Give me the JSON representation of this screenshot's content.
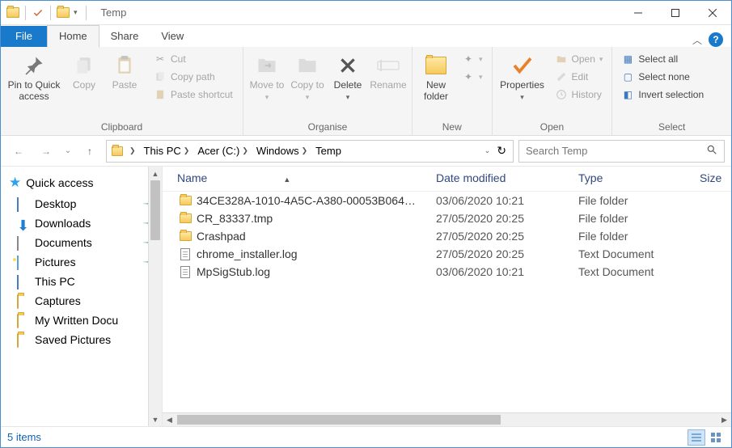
{
  "title": "Temp",
  "tabs": {
    "file": "File",
    "home": "Home",
    "share": "Share",
    "view": "View"
  },
  "ribbon": {
    "clipboard": {
      "label": "Clipboard",
      "pin": "Pin to Quick access",
      "copy": "Copy",
      "paste": "Paste",
      "cut": "Cut",
      "copy_path": "Copy path",
      "paste_shortcut": "Paste shortcut"
    },
    "organise": {
      "label": "Organise",
      "move_to": "Move to",
      "copy_to": "Copy to",
      "delete": "Delete",
      "rename": "Rename"
    },
    "new": {
      "label": "New",
      "new_folder": "New folder"
    },
    "open": {
      "label": "Open",
      "properties": "Properties",
      "open": "Open",
      "edit": "Edit",
      "history": "History"
    },
    "select": {
      "label": "Select",
      "all": "Select all",
      "none": "Select none",
      "invert": "Invert selection"
    }
  },
  "breadcrumb": [
    "This PC",
    "Acer (C:)",
    "Windows",
    "Temp"
  ],
  "search_placeholder": "Search Temp",
  "columns": {
    "name": "Name",
    "date": "Date modified",
    "type": "Type",
    "size": "Size"
  },
  "sidebar": {
    "quick": "Quick access",
    "items": [
      {
        "label": "Desktop",
        "pin": true,
        "icon": "desktop"
      },
      {
        "label": "Downloads",
        "pin": true,
        "icon": "download"
      },
      {
        "label": "Documents",
        "pin": true,
        "icon": "document"
      },
      {
        "label": "Pictures",
        "pin": true,
        "icon": "picture"
      },
      {
        "label": "This PC",
        "pin": false,
        "icon": "monitor"
      },
      {
        "label": "Captures",
        "pin": false,
        "icon": "folder"
      },
      {
        "label": "My Written Docu",
        "pin": false,
        "icon": "folder"
      },
      {
        "label": "Saved Pictures",
        "pin": false,
        "icon": "folder"
      }
    ]
  },
  "files": [
    {
      "name": "34CE328A-1010-4A5C-A380-00053B064…",
      "date": "03/06/2020 10:21",
      "type": "File folder",
      "icon": "folder"
    },
    {
      "name": "CR_83337.tmp",
      "date": "27/05/2020 20:25",
      "type": "File folder",
      "icon": "folder"
    },
    {
      "name": "Crashpad",
      "date": "27/05/2020 20:25",
      "type": "File folder",
      "icon": "folder"
    },
    {
      "name": "chrome_installer.log",
      "date": "27/05/2020 20:25",
      "type": "Text Document",
      "icon": "text"
    },
    {
      "name": "MpSigStub.log",
      "date": "03/06/2020 10:21",
      "type": "Text Document",
      "icon": "text"
    }
  ],
  "status": "5 items"
}
